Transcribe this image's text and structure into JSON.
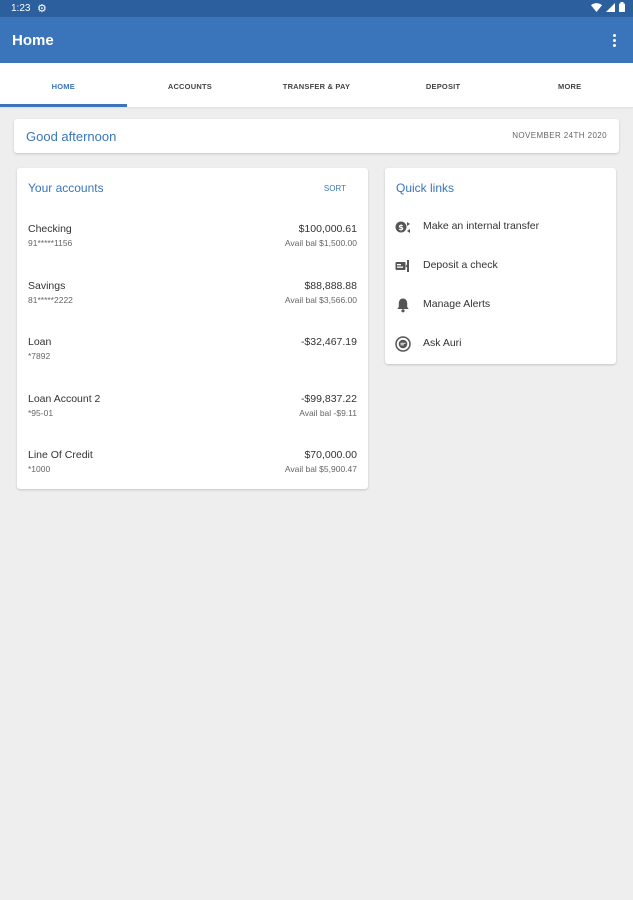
{
  "status": {
    "time": "1:23"
  },
  "appbar": {
    "title": "Home"
  },
  "tabs": [
    {
      "label": "HOME",
      "active": true
    },
    {
      "label": "ACCOUNTS"
    },
    {
      "label": "TRANSFER & PAY"
    },
    {
      "label": "DEPOSIT"
    },
    {
      "label": "MORE"
    }
  ],
  "greeting": {
    "message": "Good afternoon",
    "date": "NOVEMBER 24TH 2020"
  },
  "accounts": {
    "title": "Your accounts",
    "sort_label": "SORT",
    "items": [
      {
        "name": "Checking",
        "number": "91*****1156",
        "balance": "$100,000.61",
        "avail": "Avail bal $1,500.00"
      },
      {
        "name": "Savings",
        "number": "81*****2222",
        "balance": "$88,888.88",
        "avail": "Avail bal $3,566.00"
      },
      {
        "name": "Loan",
        "number": "*7892",
        "balance": "-$32,467.19",
        "avail": ""
      },
      {
        "name": "Loan Account 2",
        "number": "*95-01",
        "balance": "-$99,837.22",
        "avail": "Avail bal -$9.11"
      },
      {
        "name": "Line Of Credit",
        "number": "*1000",
        "balance": "$70,000.00",
        "avail": "Avail bal $5,900.47"
      }
    ]
  },
  "quick_links": {
    "title": "Quick links",
    "items": [
      {
        "label": "Make an internal transfer",
        "icon": "transfer-icon"
      },
      {
        "label": "Deposit a check",
        "icon": "check-deposit-icon"
      },
      {
        "label": "Manage Alerts",
        "icon": "bell-icon"
      },
      {
        "label": "Ask Auri",
        "icon": "chat-icon"
      }
    ]
  },
  "colors": {
    "primary": "#3a75bb",
    "statusbar": "#2c5f9e",
    "background": "#eeeeee"
  }
}
